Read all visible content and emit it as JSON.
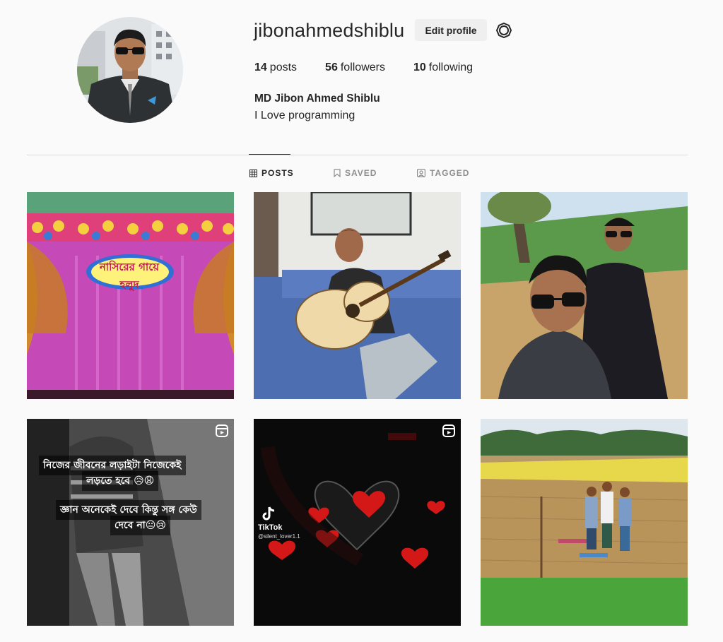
{
  "profile": {
    "username": "jibonahmedshiblu",
    "edit_label": "Edit profile",
    "posts_count": "14",
    "posts_label": "posts",
    "followers_count": "56",
    "followers_label": "followers",
    "following_count": "10",
    "following_label": "following",
    "full_name": "MD Jibon Ahmed Shiblu",
    "bio": "I Love programming"
  },
  "tabs": [
    {
      "label": "POSTS",
      "icon": "grid-icon",
      "active": true
    },
    {
      "label": "SAVED",
      "icon": "bookmark-icon",
      "active": false
    },
    {
      "label": "TAGGED",
      "icon": "tag-user-icon",
      "active": false
    }
  ],
  "posts": [
    {
      "overlay": "নাসিরের গায়ে হলুদ"
    },
    {},
    {},
    {
      "overlay_line1": "নিজের জীবনের লড়াইটা নিজেকেই",
      "overlay_line2": "লড়তে হবে 😥😩",
      "overlay_line3": "জ্ঞান অনেকেই দেবে কিন্তু সঙ্গ কেউ",
      "overlay_line4": "দেবে না😐😢",
      "reel": true
    },
    {
      "brand": "TikTok",
      "handle": "@silent_lover1.1",
      "reel": true
    },
    {}
  ],
  "colors": {
    "accent_text": "#262626",
    "muted": "#8e8e8e",
    "button_bg": "#efefef",
    "background": "#fafafa"
  }
}
